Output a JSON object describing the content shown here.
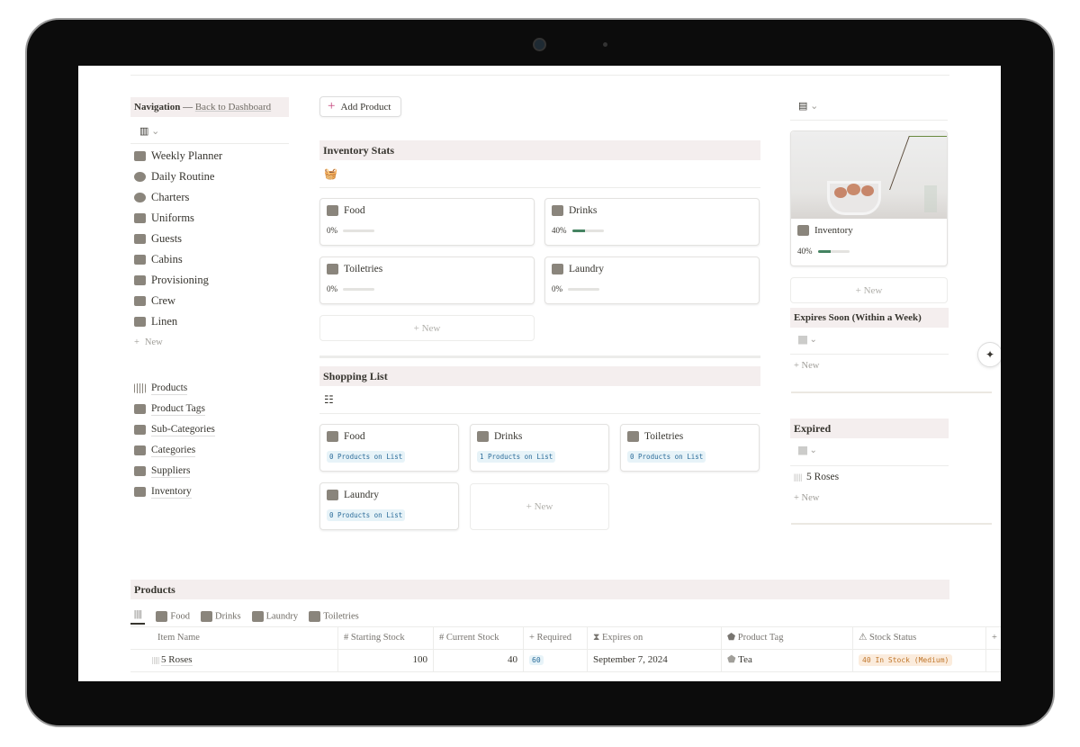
{
  "navigation": {
    "title": "Navigation",
    "separator": " — ",
    "back_link": "Back to Dashboard",
    "items": [
      {
        "label": "Weekly Planner",
        "icon": "calendar-icon"
      },
      {
        "label": "Daily Routine",
        "icon": "history-icon"
      },
      {
        "label": "Charters",
        "icon": "ship-wheel-icon"
      },
      {
        "label": "Uniforms",
        "icon": "coat-icon"
      },
      {
        "label": "Guests",
        "icon": "people-icon"
      },
      {
        "label": "Cabins",
        "icon": "armchair-icon"
      },
      {
        "label": "Provisioning",
        "icon": "groceries-icon"
      },
      {
        "label": "Crew",
        "icon": "group-icon"
      },
      {
        "label": "Linen",
        "icon": "bed-icon"
      }
    ],
    "new_label": "New",
    "db_items": [
      {
        "label": "Products",
        "icon": "barcode-icon"
      },
      {
        "label": "Product Tags",
        "icon": "tag-icon"
      },
      {
        "label": "Sub-Categories",
        "icon": "subcategory-icon"
      },
      {
        "label": "Categories",
        "icon": "shapes-icon"
      },
      {
        "label": "Suppliers",
        "icon": "truck-icon"
      },
      {
        "label": "Inventory",
        "icon": "store-icon"
      }
    ]
  },
  "add_product": "Add Product",
  "inventory_stats": {
    "title": "Inventory Stats",
    "new_label": "New",
    "cards": [
      {
        "label": "Food",
        "percent": "0%",
        "value": 0
      },
      {
        "label": "Drinks",
        "percent": "40%",
        "value": 40
      },
      {
        "label": "Toiletries",
        "percent": "0%",
        "value": 0
      },
      {
        "label": "Laundry",
        "percent": "0%",
        "value": 0
      }
    ]
  },
  "shopping_list": {
    "title": "Shopping List",
    "new_label": "New",
    "cards": [
      {
        "label": "Food",
        "count": "0 Products on List"
      },
      {
        "label": "Drinks",
        "count": "1 Products on List"
      },
      {
        "label": "Toiletries",
        "count": "0 Products on List"
      },
      {
        "label": "Laundry",
        "count": "0 Products on List"
      }
    ]
  },
  "inventory_card": {
    "label": "Inventory",
    "percent": "40%",
    "value": 40,
    "new_label": "New"
  },
  "expires_soon": {
    "title": "Expires Soon (Within a Week)",
    "new_label": "New"
  },
  "expired": {
    "title": "Expired",
    "items": [
      "5 Roses"
    ],
    "new_label": "New"
  },
  "products": {
    "title": "Products",
    "tabs": [
      "Food",
      "Drinks",
      "Laundry",
      "Toiletries"
    ],
    "columns": [
      "Item Name",
      "Starting Stock",
      "Current Stock",
      "Required",
      "Expires on",
      "Product Tag",
      "Stock Status"
    ],
    "rows": [
      {
        "name": "5 Roses",
        "starting": "100",
        "current": "40",
        "required": "60",
        "expires": "September 7, 2024",
        "tag": "Tea",
        "status": "40 In Stock (Medium)"
      }
    ]
  },
  "colors": {
    "progress": "#448361",
    "header_bg": "#f4eeee",
    "status_bg": "#fbecdd",
    "status_fg": "#c0762b",
    "pill_bg": "#e7f3f8"
  }
}
